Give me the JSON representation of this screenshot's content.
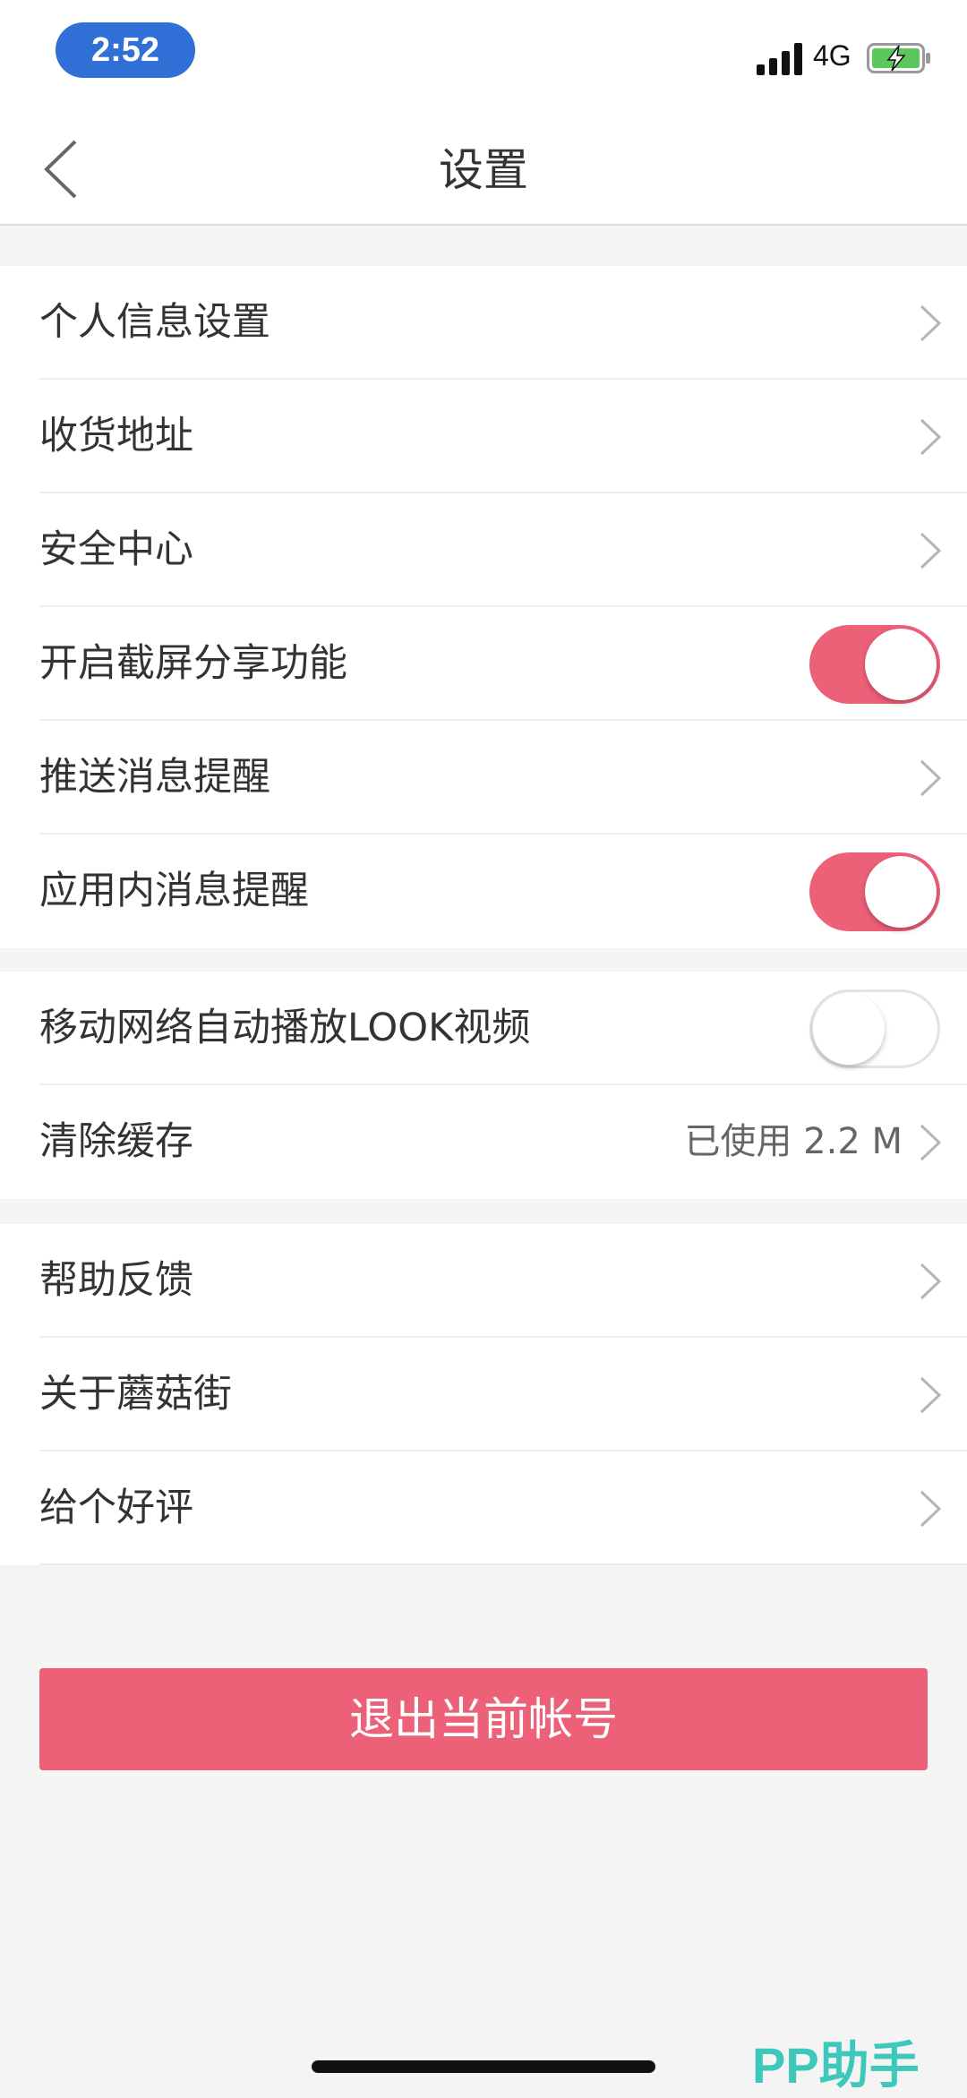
{
  "status_bar": {
    "time": "2:52",
    "network": "4G",
    "icons": [
      "signal-icon",
      "battery-charging-icon"
    ]
  },
  "nav": {
    "title": "设置",
    "back_icon": "back-icon"
  },
  "groups": [
    {
      "items": [
        {
          "label": "个人信息设置",
          "control": "chevron"
        },
        {
          "label": "收货地址",
          "control": "chevron"
        },
        {
          "label": "安全中心",
          "control": "chevron"
        },
        {
          "label": "开启截屏分享功能",
          "control": "toggle",
          "on": true
        },
        {
          "label": "推送消息提醒",
          "control": "chevron"
        },
        {
          "label": "应用内消息提醒",
          "control": "toggle",
          "on": true
        }
      ]
    },
    {
      "items": [
        {
          "label": "移动网络自动播放LOOK视频",
          "control": "toggle",
          "on": false
        },
        {
          "label": "清除缓存",
          "value": "已使用 2.2 M",
          "control": "chevron"
        }
      ]
    },
    {
      "items": [
        {
          "label": "帮助反馈",
          "control": "chevron"
        },
        {
          "label": "关于蘑菇街",
          "control": "chevron"
        },
        {
          "label": "给个好评",
          "control": "chevron"
        }
      ]
    }
  ],
  "logout_label": "退出当前帐号",
  "watermark": "PP助手",
  "colors": {
    "accent": "#ec6078",
    "background": "#f4f4f4",
    "status_pill": "#2f6fd6",
    "watermark": "#3ec7bb"
  }
}
